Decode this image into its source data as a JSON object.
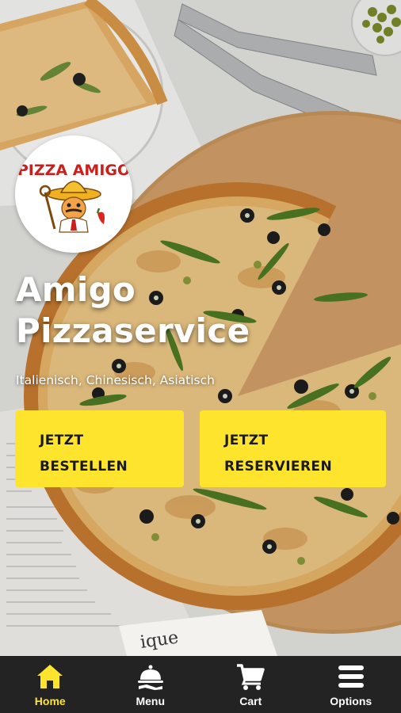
{
  "brand": {
    "logo_text": "PIZZA AMIGO",
    "title_line1": "Amigo",
    "title_line2": "Pizzaservice",
    "subtitle": "Italienisch, Chinesisch, Asiatisch"
  },
  "actions": {
    "order_line1": "JETZT",
    "order_line2": "BESTELLEN",
    "reserve_line1": "JETZT",
    "reserve_line2": "RESERVIEREN"
  },
  "nav": {
    "items": [
      {
        "label": "Home",
        "icon": "home-icon",
        "active": true
      },
      {
        "label": "Menu",
        "icon": "serving-dish-icon",
        "active": false
      },
      {
        "label": "Cart",
        "icon": "cart-icon",
        "active": false
      },
      {
        "label": "Options",
        "icon": "menu-lines-icon",
        "active": false
      }
    ]
  },
  "colors": {
    "accent": "#ffe42d",
    "nav_background": "#232323",
    "nav_label": "#ffffff",
    "headline": "#ffffff"
  }
}
